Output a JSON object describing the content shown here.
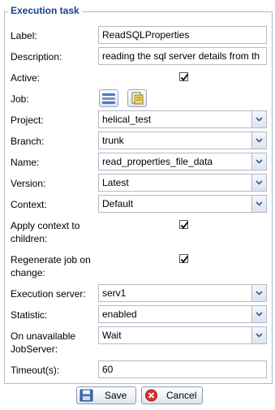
{
  "form": {
    "legend": "Execution task",
    "label": {
      "caption": "Label:",
      "value": "ReadSQLProperties"
    },
    "description": {
      "caption": "Description:",
      "value": "reading the sql server details from th"
    },
    "active": {
      "caption": "Active:",
      "checked": true
    },
    "job": {
      "caption": "Job:"
    },
    "project": {
      "caption": "Project:",
      "value": "helical_test"
    },
    "branch": {
      "caption": "Branch:",
      "value": "trunk"
    },
    "name": {
      "caption": "Name:",
      "value": "read_properties_file_data"
    },
    "version": {
      "caption": "Version:",
      "value": "Latest"
    },
    "context": {
      "caption": "Context:",
      "value": "Default"
    },
    "apply_context": {
      "caption_line1": "Apply context to",
      "caption_line2": "children:",
      "checked": true
    },
    "regenerate": {
      "caption_line1": "Regenerate job on",
      "caption_line2": "change:",
      "checked": true
    },
    "execution_server": {
      "caption": "Execution server:",
      "value": "serv1"
    },
    "statistic": {
      "caption": "Statistic:",
      "value": "enabled"
    },
    "unavailable": {
      "caption_line1": "On unavailable",
      "caption_line2": "JobServer:",
      "value": "Wait"
    },
    "timeout": {
      "caption": "Timeout(s):",
      "value": "60"
    }
  },
  "buttons": {
    "save": "Save",
    "cancel": "Cancel"
  },
  "colors": {
    "legend": "#15428b",
    "border": "#b5b8c8"
  }
}
